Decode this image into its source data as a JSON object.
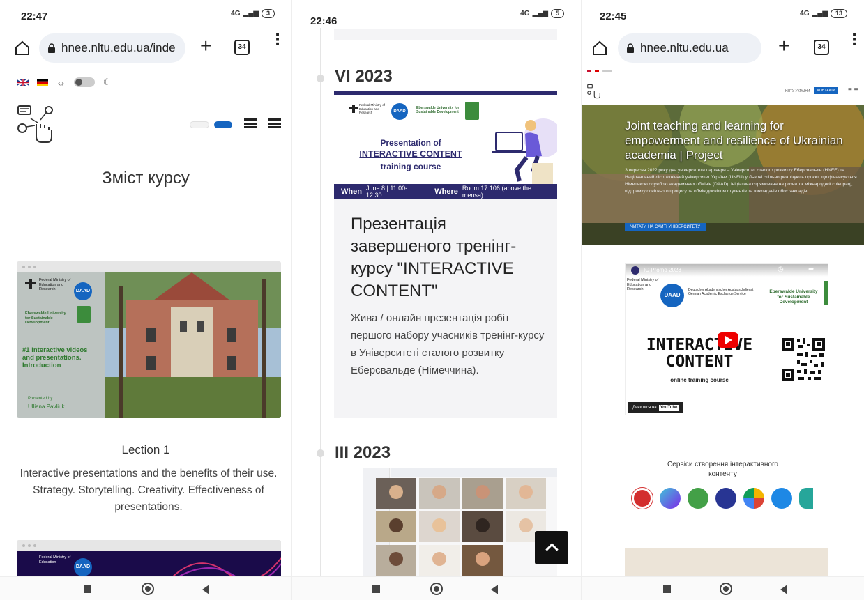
{
  "panel1": {
    "status": {
      "time": "22:47",
      "battery": "3",
      "net": "4G"
    },
    "url": "hnee.nltu.edu.ua/inde",
    "tabs_count": "34",
    "page_title": "Зміст курсу",
    "slide1": {
      "org1": "Federal Ministry of Education and Research",
      "daad": "DAAD",
      "org2": "Eberswalde University for Sustainable Development",
      "title": "#1 Interactive videos and presentations. Introduction",
      "presented": "Presented by",
      "lecturer": "Ulliana Pavliuk"
    },
    "lection_title": "Lection 1",
    "lection_desc": "Interactive presentations and the benefits of their use. Strategy. Storytelling. Creativity. Effectiveness of presentations.",
    "slide2": {
      "org1": "Federal Ministry of Education",
      "daad": "DAAD"
    }
  },
  "panel2": {
    "status": {
      "time": "22:46",
      "battery": "5",
      "net": "4G"
    },
    "date1": "VI 2023",
    "banner": {
      "org1": "Federal Ministry of Education and Research",
      "daad": "DAAD",
      "org2": "Eberswalde University for Sustainable Development",
      "line1": "Presentation of",
      "line2": "INTERACTIVE CONTENT",
      "line3": "training course",
      "when_label": "When",
      "when_value": "June 8 | 11.00-12.30",
      "where_label": "Where",
      "where_value": "Room 17.106 (above the mensa)"
    },
    "post_title": "Презентація завершеного тренінг-курсу \"INTERACTIVE CONTENT\"",
    "post_desc": "Жива / онлайн презентація робіт першого набору учасників тренінг-курсу в Університеті сталого розвитку Еберсвальде (Німеччина).",
    "date2": "III 2023"
  },
  "panel3": {
    "status": {
      "time": "22:45",
      "battery": "13",
      "net": "4G"
    },
    "url": "hnee.nltu.edu.ua",
    "tabs_count": "34",
    "nav_link": "НЛТУ УКРАЇНИ",
    "nav_btn": "КОНТАКТИ",
    "hero_title": "Joint teaching and learning for empowerment and resilience of Ukrainian academia | Project",
    "hero_desc": "З вересня 2022 року два університети партнери – Університет сталого розвитку Еберсвальде (HNEE) та Національний лісотехнічний університет України (UNFU) у Львові спільно реалізують проєкт, що фінансується Німецькою службою академічних обмінів (DAAD). Ініціатива спрямована на розвиток міжнародної співпраці, підтримку освітнього процесу та обмін досвідом студентів та викладачів обох закладів.",
    "hero_btn": "ЧИТАТИ НА САЙТІ УНІВЕРСИТЕТУ",
    "video": {
      "title": "IC Promo 2023",
      "org1": "Federal Ministry of Education and Research",
      "daad": "DAAD",
      "daad_desc": "Deutscher Akademischer Austauschdienst German Academic Exchange Service",
      "org2": "Eberswalde University for Sustainable Development",
      "big1": "INTERACTIVE",
      "big2": "CONTENT",
      "sub": "online training course",
      "watch": "Дивитися на",
      "yt": "YouTube"
    },
    "services_title": "Сервіси створення інтерактивного контенту",
    "service_icons": [
      "genially-icon",
      "canva-icon",
      "cp-icon",
      "c-icon",
      "colors-icon",
      "h5p-icon",
      "partial-icon"
    ]
  },
  "colors": {
    "blue": "#1565c0",
    "navy": "#2d2a6e",
    "green": "#3c8c3c"
  }
}
